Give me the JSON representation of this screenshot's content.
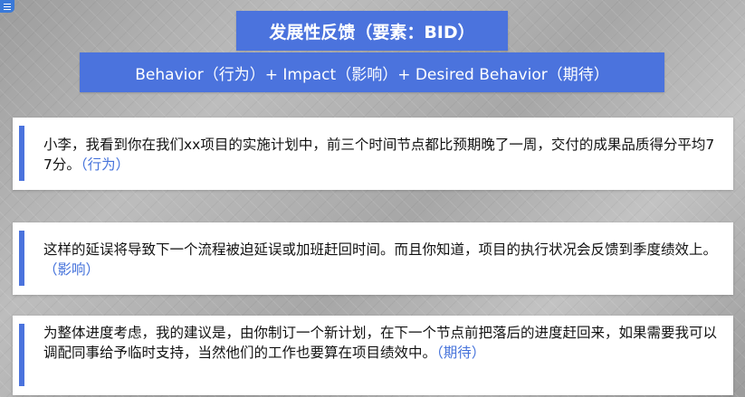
{
  "menu": {
    "icon": "hamburger-menu-icon"
  },
  "header": {
    "title": "发展性反馈（要素：BID）",
    "subtitle": "Behavior（行为）+ Impact（影响）+ Desired Behavior（期待）"
  },
  "cards": [
    {
      "text": "小李，我看到你在我们xx项目的实施计划中，前三个时间节点都比预期晚了一周，交付的成果品质得分平均77分。",
      "tag": "（行为）"
    },
    {
      "text": "这样的延误将导致下一个流程被迫延误或加班赶回时间。而且你知道，项目的执行状况会反馈到季度绩效上。",
      "tag": "（影响）"
    },
    {
      "text": "为整体进度考虑，我的建议是，由你制订一个新计划，在下一个节点前把落后的进度赶回来，如果需要我可以调配同事给予临时支持，当然他们的工作也要算在项目绩效中。",
      "tag": "（期待）"
    }
  ],
  "colors": {
    "accent": "#4b73dd",
    "tag": "#4673db",
    "card_background": "#ffffff",
    "text": "#111111"
  }
}
